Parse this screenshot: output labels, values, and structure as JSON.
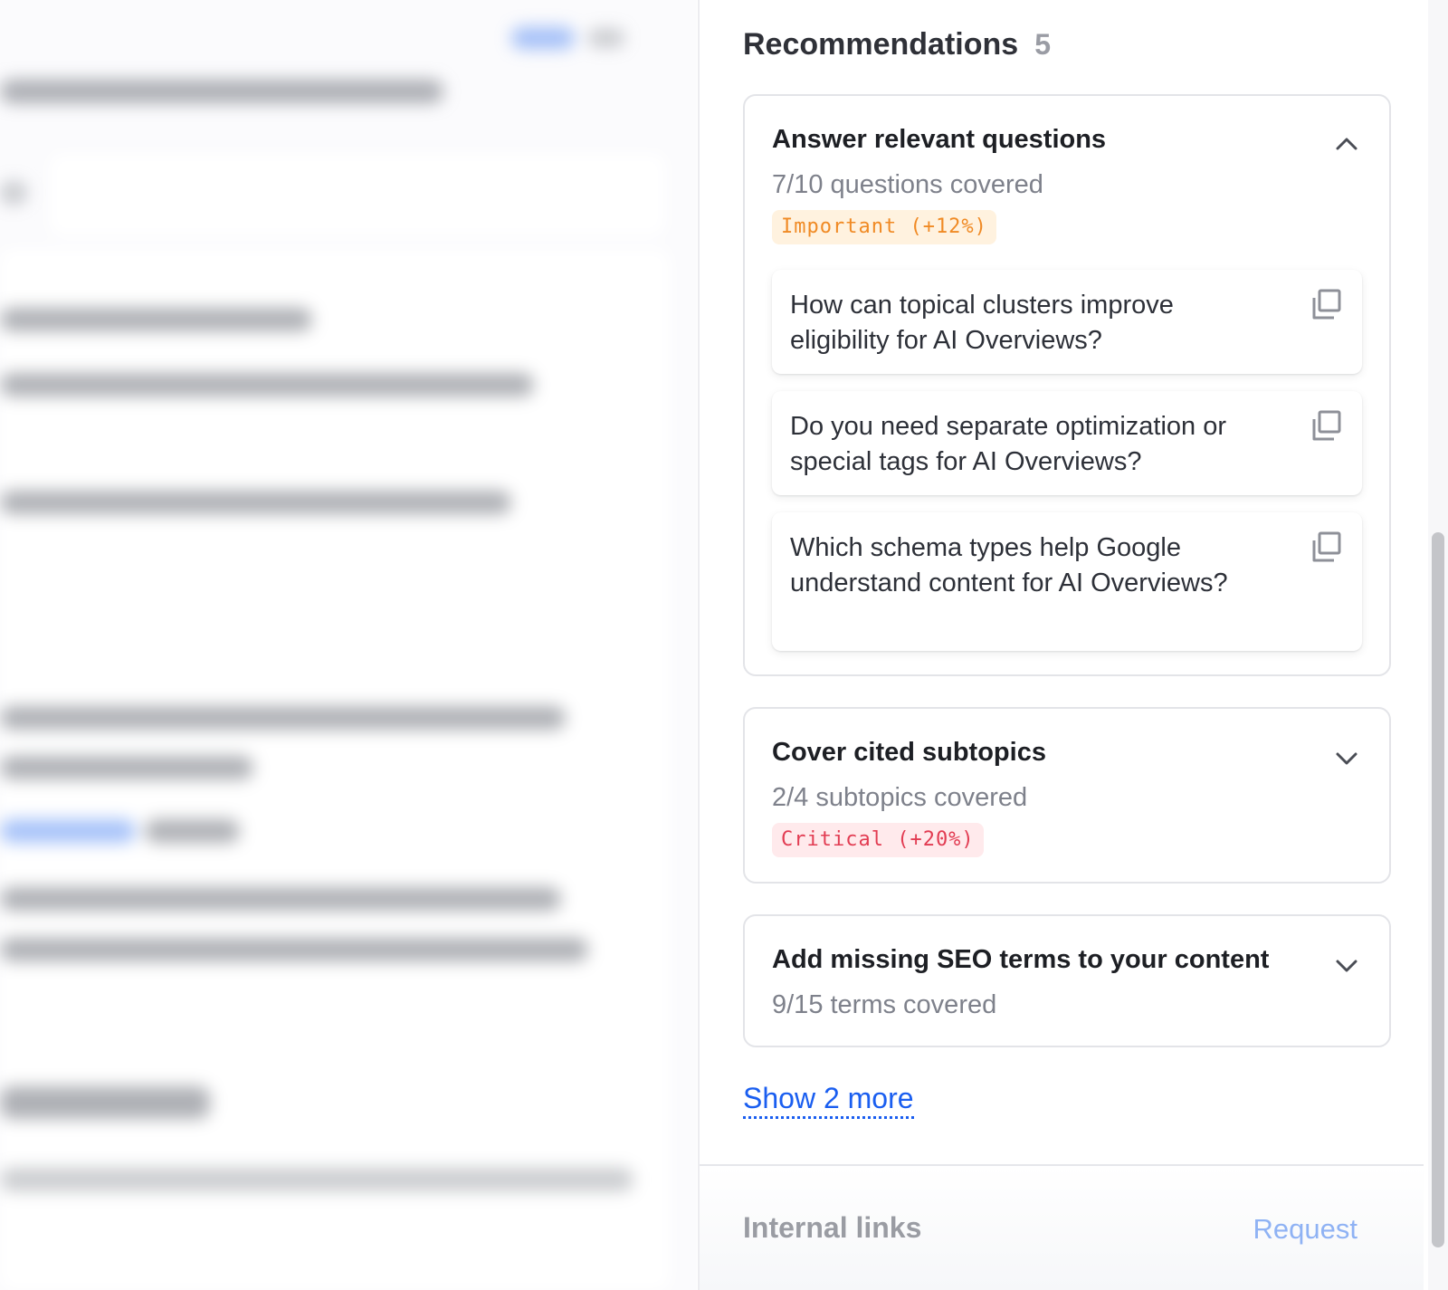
{
  "recommendations": {
    "title": "Recommendations",
    "count": "5",
    "cards": [
      {
        "title": "Answer relevant questions",
        "subtitle": "7/10 questions covered",
        "badge": "Important (+12%)",
        "expanded": true,
        "chevron_icon": "chevron-up-icon",
        "questions": [
          "How can topical clusters improve eligibility for AI Overviews?",
          "Do you need separate optimization or special tags for AI Overviews?",
          "Which schema types help Google understand content for AI Overviews?"
        ]
      },
      {
        "title": "Cover cited subtopics",
        "subtitle": "2/4 subtopics covered",
        "badge": "Critical (+20%)",
        "expanded": false,
        "chevron_icon": "chevron-down-icon"
      },
      {
        "title": "Add missing SEO terms to your content",
        "subtitle": "9/15 terms covered",
        "expanded": false,
        "chevron_icon": "chevron-down-icon"
      }
    ],
    "show_more": "Show 2 more"
  },
  "internal_links": {
    "title": "Internal links",
    "action": "Request"
  },
  "icons": {
    "copy": "copy-icon"
  },
  "colors": {
    "important_text": "#f08a24",
    "important_bg": "#fff2df",
    "critical_text": "#e23c52",
    "critical_bg": "#ffeaec",
    "link": "#1a5ef0"
  }
}
